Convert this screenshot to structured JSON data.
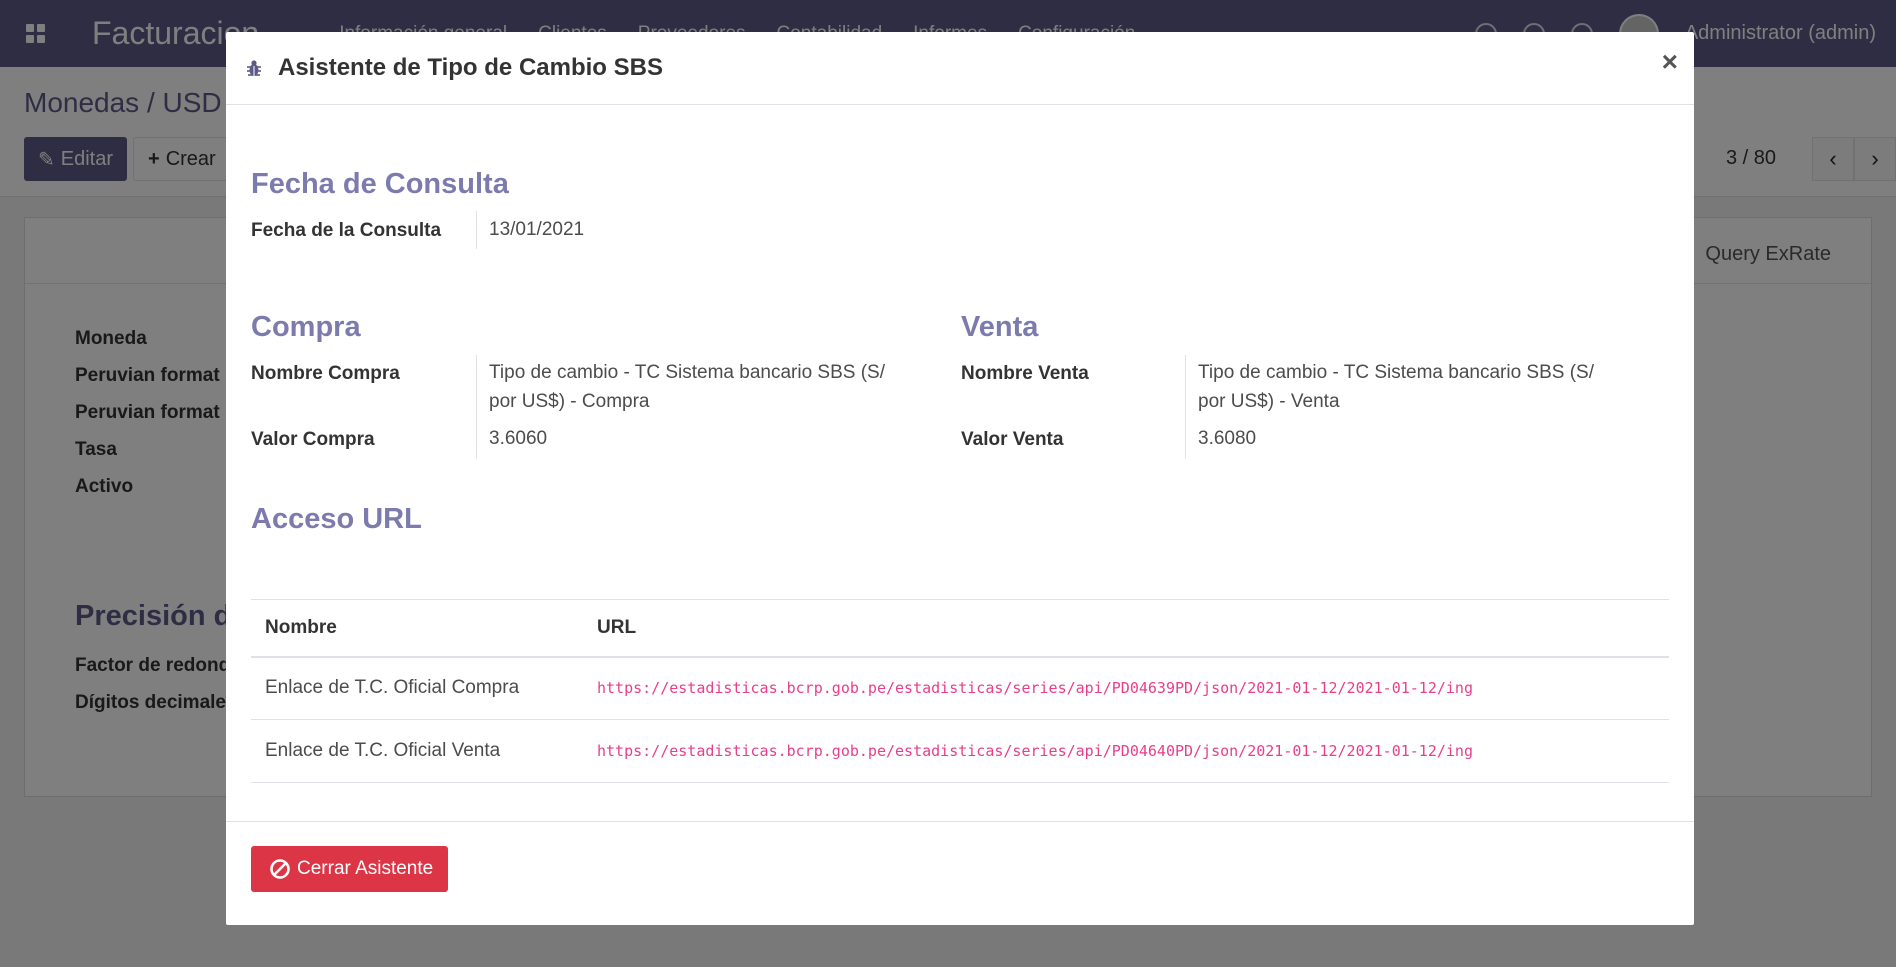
{
  "navbar": {
    "app_name": "Facturacion",
    "menu": [
      "Información general",
      "Clientes",
      "Proveedores",
      "Contabilidad",
      "Informes",
      "Configuración"
    ],
    "user": "Administrator (admin)"
  },
  "control_panel": {
    "breadcrumb": "Monedas / USD",
    "edit_label": "Editar",
    "create_label": "Crear",
    "pager": "3 / 80"
  },
  "sheet": {
    "query_label": "Query ExRate",
    "fields": [
      "Moneda",
      "Peruvian format",
      "Peruvian format",
      "Tasa",
      "Activo"
    ],
    "section": "Precisión d",
    "precision_fields": [
      "Factor de redond",
      "Dígitos decimale"
    ]
  },
  "modal": {
    "title": "Asistente de Tipo de Cambio SBS",
    "close": "×",
    "fecha_section": "Fecha de Consulta",
    "fecha_label": "Fecha de la Consulta",
    "fecha_value": "13/01/2021",
    "compra_section": "Compra",
    "nombre_compra_label": "Nombre Compra",
    "nombre_compra_value": "Tipo de cambio - TC Sistema bancario SBS (S/ por US$) - Compra",
    "valor_compra_label": "Valor Compra",
    "valor_compra_value": "3.6060",
    "venta_section": "Venta",
    "nombre_venta_label": "Nombre Venta",
    "nombre_venta_value": "Tipo de cambio - TC Sistema bancario SBS (S/ por US$) - Venta",
    "valor_venta_label": "Valor Venta",
    "valor_venta_value": "3.6080",
    "url_section": "Acceso URL",
    "table": {
      "headers": [
        "Nombre",
        "URL"
      ],
      "rows": [
        {
          "nombre": "Enlace de T.C. Oficial Compra",
          "url": "https://estadisticas.bcrp.gob.pe/estadisticas/series/api/PD04639PD/json/2021-01-12/2021-01-12/ing"
        },
        {
          "nombre": "Enlace de T.C. Oficial Venta",
          "url": "https://estadisticas.bcrp.gob.pe/estadisticas/series/api/PD04640PD/json/2021-01-12/2021-01-12/ing"
        }
      ]
    },
    "close_wizard_label": "Cerrar Asistente"
  },
  "colors": {
    "primary": "#5e5a87",
    "section_title": "#7c7bad",
    "danger": "#dc3545",
    "url_text": "#e83e8c"
  }
}
